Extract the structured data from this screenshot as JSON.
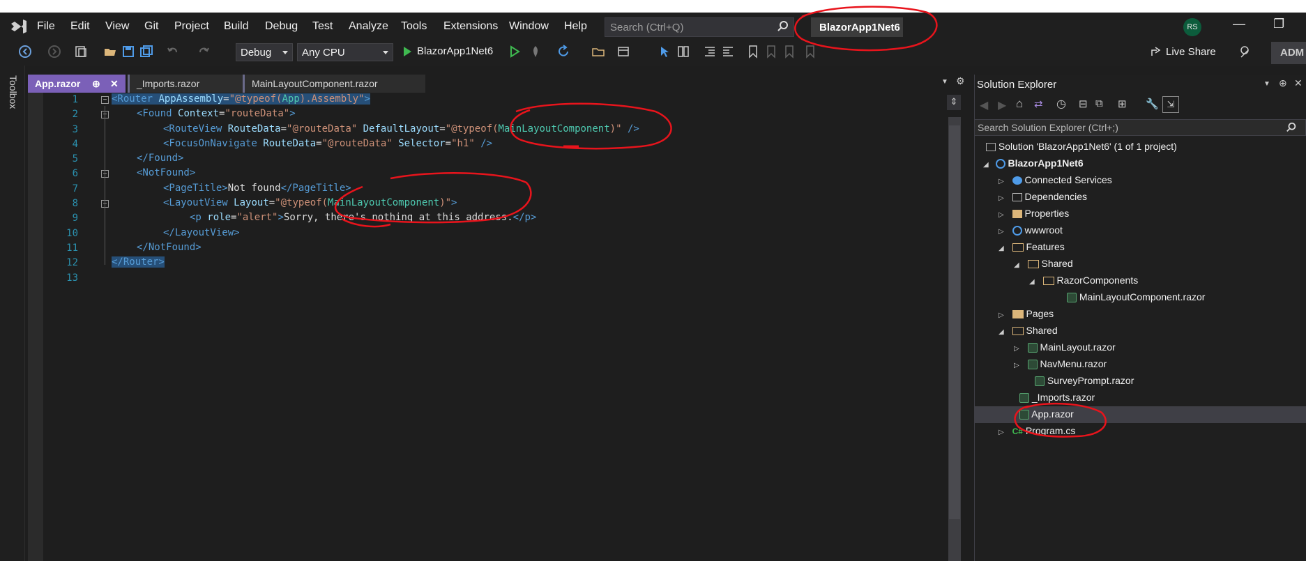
{
  "menu": [
    "File",
    "Edit",
    "View",
    "Git",
    "Project",
    "Build",
    "Debug",
    "Test",
    "Analyze",
    "Tools",
    "Extensions",
    "Window",
    "Help"
  ],
  "search": {
    "placeholder": "Search (Ctrl+Q)"
  },
  "project_name": "BlazorApp1Net6",
  "user_initials": "RS",
  "toolbar": {
    "config": "Debug",
    "platform": "Any CPU",
    "run_target": "BlazorApp1Net6",
    "live_share": "Live Share",
    "admin": "ADM"
  },
  "toolbox_label": "Toolbox",
  "tabs": [
    {
      "label": "App.razor",
      "pin": "⊕",
      "close": "✕"
    },
    {
      "label": "_Imports.razor"
    },
    {
      "label": "MainLayoutComponent.razor"
    }
  ],
  "line_numbers": [
    "1",
    "2",
    "3",
    "4",
    "5",
    "6",
    "7",
    "8",
    "9",
    "10",
    "11",
    "12",
    "13"
  ],
  "code": {
    "l1": [
      "<Router",
      "AppAssembly",
      "=",
      "\"@typeof(",
      "App",
      ").Assembly\"",
      ">"
    ],
    "l2": [
      "<Found",
      "Context",
      "=",
      "\"routeData\"",
      ">"
    ],
    "l3": [
      "<RouteView",
      "RouteData",
      "=",
      "\"@routeData\"",
      "DefaultLayout",
      "=",
      "\"@typeof(",
      "MainLayoutComponent",
      ")\"",
      "/>"
    ],
    "l4": [
      "<FocusOnNavigate",
      "RouteData",
      "=",
      "\"@routeData\"",
      "Selector",
      "=",
      "\"h1\"",
      "/>"
    ],
    "l5": [
      "</Found>"
    ],
    "l6": [
      "<NotFound>"
    ],
    "l7": [
      "<PageTitle>",
      "Not found",
      "</PageTitle>"
    ],
    "l8": [
      "<LayoutView",
      "Layout",
      "=",
      "\"@typeof(",
      "MainLayoutComponent",
      ")\"",
      ">"
    ],
    "l9": [
      "<p",
      "role",
      "=",
      "\"alert\"",
      ">",
      "Sorry, there's nothing at this address.",
      "</p>"
    ],
    "l10": [
      "</LayoutView>"
    ],
    "l11": [
      "</NotFound>"
    ],
    "l12": [
      "</Router>"
    ]
  },
  "solution_explorer": {
    "title": "Solution Explorer",
    "search_placeholder": "Search Solution Explorer (Ctrl+;)",
    "items": [
      {
        "label": "Solution 'BlazorApp1Net6' (1 of 1 project)"
      },
      {
        "label": "BlazorApp1Net6"
      },
      {
        "label": "Connected Services"
      },
      {
        "label": "Dependencies"
      },
      {
        "label": "Properties"
      },
      {
        "label": "wwwroot"
      },
      {
        "label": "Features"
      },
      {
        "label": "Shared"
      },
      {
        "label": "RazorComponents"
      },
      {
        "label": "MainLayoutComponent.razor"
      },
      {
        "label": "Pages"
      },
      {
        "label": "Shared"
      },
      {
        "label": "MainLayout.razor"
      },
      {
        "label": "NavMenu.razor"
      },
      {
        "label": "SurveyPrompt.razor"
      },
      {
        "label": "_Imports.razor"
      },
      {
        "label": "App.razor"
      },
      {
        "label": "Program.cs"
      }
    ]
  },
  "colors": {
    "accent_tab": "#7b60b8",
    "annotation": "#e8141c",
    "keyword": "#569cd6",
    "type": "#4ec9b0",
    "string": "#ce9178",
    "attribute": "#9cdcfe"
  }
}
